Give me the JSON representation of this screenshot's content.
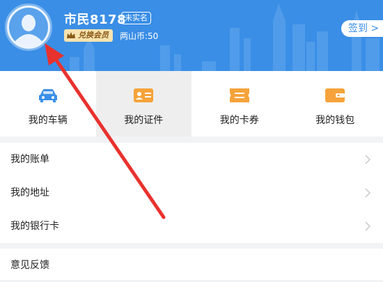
{
  "profile": {
    "username": "市民8178",
    "realname_badge": "未实名",
    "member_badge": "兑换会员",
    "coins": "两山币:50",
    "signin_label": "签到 >"
  },
  "grid": [
    {
      "label": "我的车辆",
      "icon": "car-icon"
    },
    {
      "label": "我的证件",
      "icon": "id-card-icon"
    },
    {
      "label": "我的卡券",
      "icon": "coupon-icon"
    },
    {
      "label": "我的钱包",
      "icon": "wallet-icon"
    }
  ],
  "list": [
    {
      "label": "我的账单"
    },
    {
      "label": "我的地址"
    },
    {
      "label": "我的银行卡"
    }
  ],
  "list2": [
    {
      "label": "意见反馈"
    }
  ],
  "colors": {
    "header_blue": "#3a8ee6",
    "icon_blue": "#3b8fe8",
    "icon_orange": "#f5a33a",
    "arrow_red": "#e8322e"
  }
}
